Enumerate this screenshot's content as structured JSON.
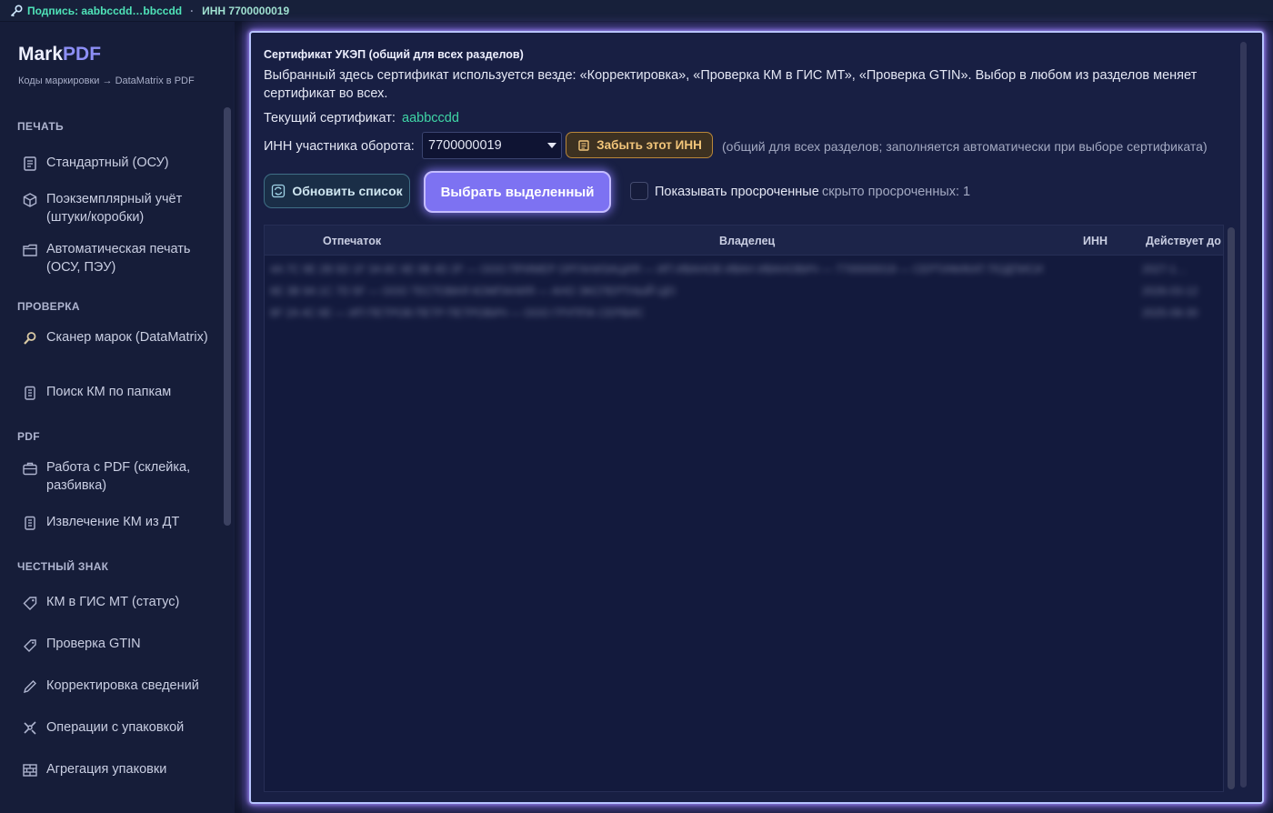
{
  "statusbar": {
    "signature": "Подпись: aabbccdd…bbccdd",
    "separator": "·",
    "inn": "ИНН 7700000019"
  },
  "sidebar": {
    "brand_main": "Mark",
    "brand_accent": "PDF",
    "subtitle": "Коды маркировки → DataMatrix в PDF",
    "sections": {
      "print": "ПЕЧАТЬ",
      "check": "ПРОВЕРКА",
      "pdf": "PDF",
      "honest": "ЧЕСТНЫЙ ЗНАК"
    },
    "items": [
      {
        "label": "Стандартный (ОСУ)",
        "icon": "document-icon"
      },
      {
        "label": "Поэкземплярный учёт (штуки/коробки)",
        "icon": "box-icon"
      },
      {
        "label": "Автоматическая печать (ОСУ, ПЭУ)",
        "icon": "folder-icon"
      },
      {
        "label": "Сканер марок (DataMatrix)",
        "icon": "magnifier-icon"
      },
      {
        "label": "Поиск КМ по папкам",
        "icon": "clipboard-icon"
      },
      {
        "label": "Работа с PDF (склейка, разбивка)",
        "icon": "briefcase-icon"
      },
      {
        "label": "Извлечение КМ из ДТ",
        "icon": "clipboard-icon"
      },
      {
        "label": "КМ в ГИС МТ (статус)",
        "icon": "tag-icon"
      },
      {
        "label": "Проверка GTIN",
        "icon": "label-icon"
      },
      {
        "label": "Корректировка сведений",
        "icon": "pencil-icon"
      },
      {
        "label": "Операции с упаковкой",
        "icon": "tools-icon"
      },
      {
        "label": "Агрегация упаковки",
        "icon": "bricks-icon"
      }
    ]
  },
  "main": {
    "title": "Сертификат УКЭП (общий для всех разделов)",
    "description": "Выбранный здесь сертификат используется везде: «Корректировка», «Проверка КМ в ГИС МТ», «Проверка GTIN». Выбор в любом из разделов меняет сертификат во всех.",
    "current_cert_label": "Текущий сертификат:",
    "current_cert_value": "aabbccdd",
    "inn_label": "ИНН участника оборота:",
    "inn_value": "7700000019",
    "forget_button": "Забыть этот ИНН",
    "inn_hint": "(общий для всех разделов; заполняется автоматически при выборе сертификата)",
    "refresh_button": "Обновить список",
    "select_button": "Выбрать выделенный",
    "show_expired_label": "Показывать просроченные",
    "hidden_count": "скрыто просроченных: 1",
    "table": {
      "columns": [
        "Отпечаток",
        "Владелец",
        "ИНН",
        "Действует до"
      ],
      "rows": [
        {
          "text": "4A 7C 9E 2B 5D 1F 3A 8C 6E 0B 4D 2F — ООО ПРИМЕР ОРГАНИЗАЦИЯ — ИП ИВАНОВ ИВАН ИВАНОВИЧ — 7700000019 — СЕРТИФИКАТ ПОДПИСИ",
          "date": "2027-1…"
        },
        {
          "text": "6E 3B 9A 1C 7D 5F — ООО ТЕСТОВАЯ КОМПАНИЯ — АНО ЭКСПЕРТНЫЙ ЦЕНТР",
          "date": "2026-03-12"
        },
        {
          "text": "8F 2A 4C 6E — ИП ПЕТРОВ ПЕТР ПЕТРОВИЧ — ООО ГРУППА СЕРВИС",
          "date": "2025-08-30"
        }
      ]
    }
  }
}
